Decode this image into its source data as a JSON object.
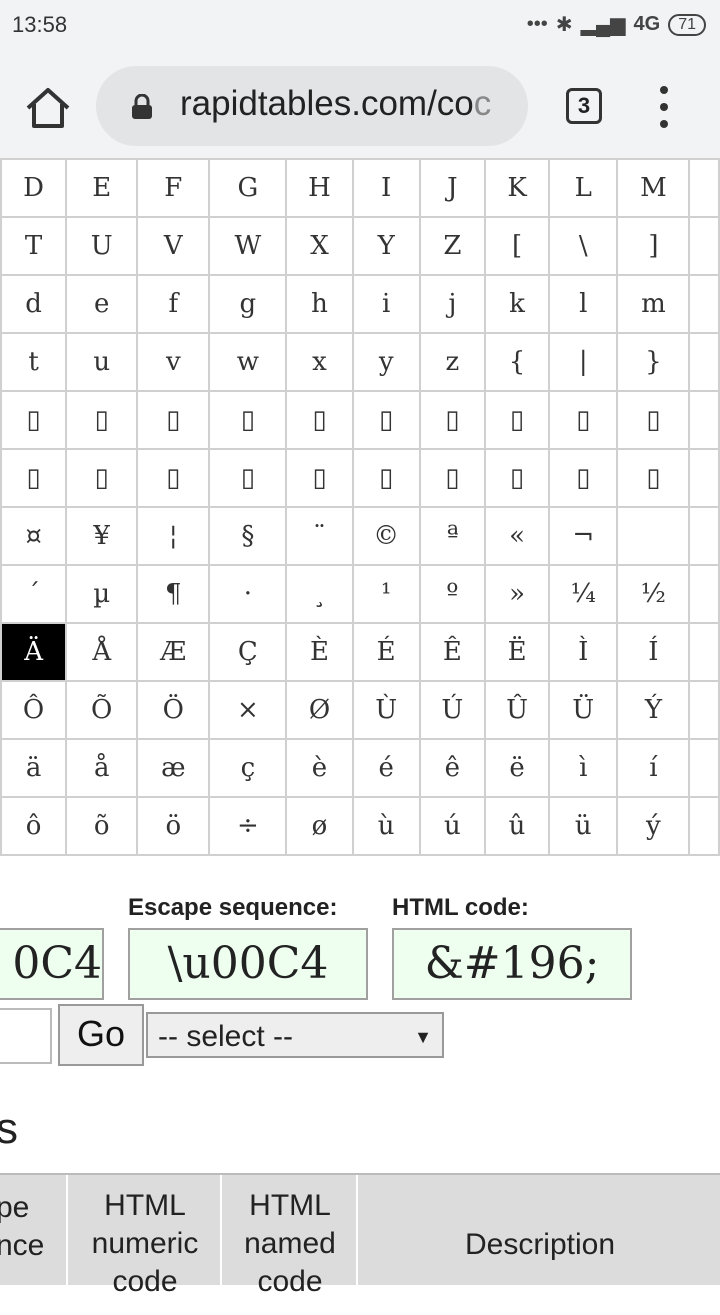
{
  "status": {
    "time": "13:58",
    "network": "4G",
    "battery": "71"
  },
  "browser": {
    "url_visible": "rapidtables.com/co",
    "url_faded": "c",
    "tab_count": "3"
  },
  "char_table": {
    "rows": [
      [
        "D",
        "E",
        "F",
        "G",
        "H",
        "I",
        "J",
        "K",
        "L",
        "M"
      ],
      [
        "T",
        "U",
        "V",
        "W",
        "X",
        "Y",
        "Z",
        "[",
        "\\",
        "]"
      ],
      [
        "d",
        "e",
        "f",
        "g",
        "h",
        "i",
        "j",
        "k",
        "l",
        "m"
      ],
      [
        "t",
        "u",
        "v",
        "w",
        "x",
        "y",
        "z",
        "{",
        "|",
        "}"
      ],
      [
        "▯",
        "▯",
        "▯",
        "▯",
        "▯",
        "▯",
        "▯",
        "▯",
        "▯",
        "▯"
      ],
      [
        "▯",
        "▯",
        "▯",
        "▯",
        "▯",
        "▯",
        "▯",
        "▯",
        "▯",
        "▯"
      ],
      [
        "¤",
        "¥",
        "¦",
        "§",
        "¨",
        "©",
        "ª",
        "«",
        "¬",
        ""
      ],
      [
        "´",
        "µ",
        "¶",
        "·",
        "¸",
        "¹",
        "º",
        "»",
        "¼",
        "½"
      ],
      [
        "Ä",
        "Å",
        "Æ",
        "Ç",
        "È",
        "É",
        "Ê",
        "Ë",
        "Ì",
        "Í"
      ],
      [
        "Ô",
        "Õ",
        "Ö",
        "×",
        "Ø",
        "Ù",
        "Ú",
        "Û",
        "Ü",
        "Ý"
      ],
      [
        "ä",
        "å",
        "æ",
        "ç",
        "è",
        "é",
        "ê",
        "ë",
        "ì",
        "í"
      ],
      [
        "ô",
        "õ",
        "ö",
        "÷",
        "ø",
        "ù",
        "ú",
        "û",
        "ü",
        "ý"
      ]
    ],
    "selected": "Ä"
  },
  "codes": {
    "unicode_partial": "0C4",
    "escape_label": "Escape sequence:",
    "escape_value": "\\u00C4",
    "html_label": "HTML code:",
    "html_value": "&#196;"
  },
  "controls": {
    "go_label": "Go",
    "select_value": "-- select --",
    "select_arrow": "▼"
  },
  "section_heading_fragment": "s",
  "table_header": {
    "col1": [
      "pe",
      "nce"
    ],
    "col2": [
      "HTML",
      "numeric",
      "code"
    ],
    "col3": [
      "HTML",
      "named",
      "code"
    ],
    "col4": "Description"
  }
}
